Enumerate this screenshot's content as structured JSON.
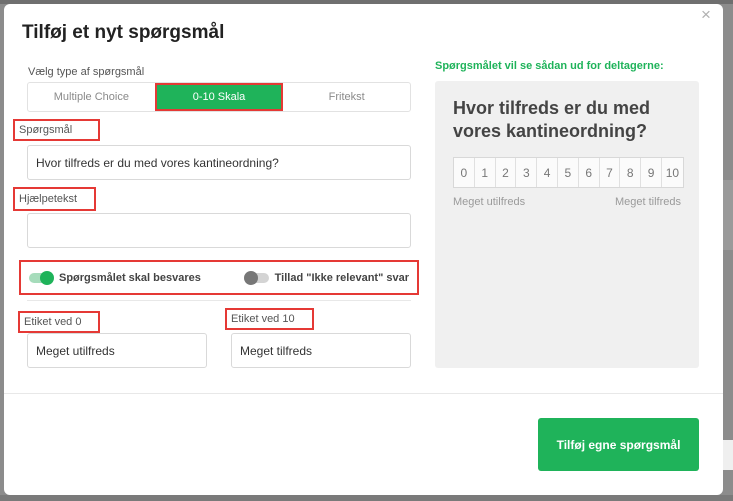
{
  "modal": {
    "title": "Tilføj et nyt spørgsmål",
    "close_glyph": "×"
  },
  "question_type": {
    "label": "Vælg type af spørgsmål",
    "options": [
      "Multiple Choice",
      "0-10 Skala",
      "Fritekst"
    ],
    "selected": "0-10 Skala"
  },
  "question": {
    "label": "Spørgsmål",
    "value": "Hvor tilfreds er du med vores kantineordning?"
  },
  "help_text": {
    "label": "Hjælpetekst",
    "value": ""
  },
  "toggles": {
    "required": {
      "label": "Spørgsmålet skal besvares",
      "on": true
    },
    "not_relevant": {
      "label": "Tillad \"Ikke relevant\" svar",
      "on": false
    }
  },
  "label_0": {
    "label": "Etiket ved 0",
    "value": "Meget utilfreds"
  },
  "label_10": {
    "label": "Etiket ved 10",
    "value": "Meget tilfreds"
  },
  "preview": {
    "heading": "Spørgsmålet vil se sådan ud for deltagerne:",
    "question": "Hvor tilfreds er du med vores kantineordning?",
    "scale": [
      "0",
      "1",
      "2",
      "3",
      "4",
      "5",
      "6",
      "7",
      "8",
      "9",
      "10"
    ],
    "low_label": "Meget utilfreds",
    "high_label": "Meget tilfreds"
  },
  "submit_label": "Tilføj egne spørgsmål",
  "colors": {
    "accent": "#1fb35a",
    "highlight": "#e53935"
  }
}
